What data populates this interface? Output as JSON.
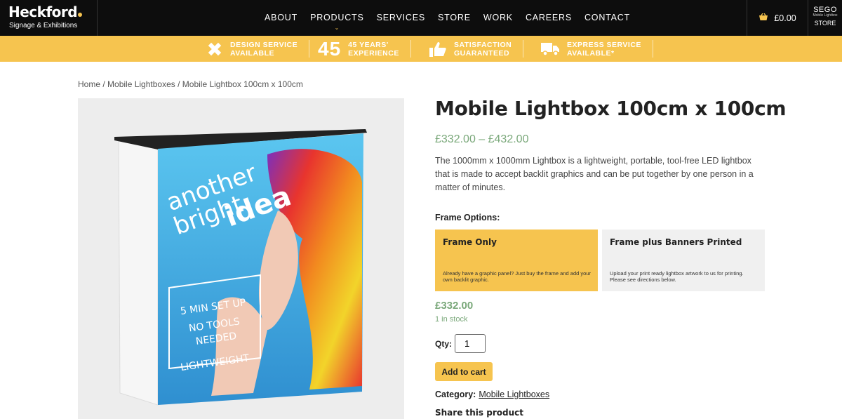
{
  "header": {
    "logo_main": "Heckford",
    "logo_sub": "Signage & Exhibitions",
    "nav": [
      {
        "label": "ABOUT"
      },
      {
        "label": "PRODUCTS"
      },
      {
        "label": "SERVICES"
      },
      {
        "label": "STORE"
      },
      {
        "label": "WORK"
      },
      {
        "label": "CAREERS"
      },
      {
        "label": "CONTACT"
      }
    ],
    "cart_total": "£0.00",
    "store_brand": "SEGO",
    "store_tiny": "Mobile Lightbox",
    "store_label": "STORE"
  },
  "banner": {
    "items": [
      {
        "line1": "DESIGN SERVICE",
        "line2": "AVAILABLE",
        "icon": "pencil-ruler-icon"
      },
      {
        "big": "45",
        "line1": "45 YEARS'",
        "line2": "EXPERIENCE"
      },
      {
        "line1": "SATISFACTION",
        "line2": "GUARANTEED",
        "icon": "thumbs-up-icon"
      },
      {
        "line1": "EXPRESS SERVICE",
        "line2": "AVAILABLE*",
        "icon": "truck-icon"
      }
    ]
  },
  "breadcrumb": {
    "home": "Home",
    "category": "Mobile Lightboxes",
    "current": "Mobile Lightbox 100cm x 100cm",
    "separator": " / "
  },
  "product_image": {
    "text_line1": "another",
    "text_line2": "bright",
    "text_line3": "idea",
    "box_line1": "5 MIN SET UP",
    "box_line2": "NO TOOLS",
    "box_line3": "NEEDED",
    "box_line4": "LIGHTWEIGHT"
  },
  "product": {
    "title": "Mobile Lightbox 100cm x 100cm",
    "price_range": "£332.00 – £432.00",
    "description": "The 1000mm x 1000mm Lightbox is a lightweight, portable, tool-free LED lightbox that is made to accept backlit graphics and can be put together by one person in a matter of minutes.",
    "frame_options_label": "Frame Options:",
    "options": [
      {
        "title": "Frame Only",
        "text": "Already have a graphic panel? Just buy the frame and add your own backlit graphic.",
        "selected": true
      },
      {
        "title": "Frame plus Banners Printed",
        "text": "Upload your print ready lightbox artwork to us for printing. Please see directions below.",
        "selected": false
      }
    ],
    "price": "£332.00",
    "stock": "1 in stock",
    "qty_label": "Qty:",
    "qty_value": "1",
    "add_to_cart": "Add to cart",
    "category_label": "Category:",
    "category_link": "Mobile Lightboxes",
    "share_label": "Share this product"
  },
  "colors": {
    "accent": "#f6c44f",
    "header_bg": "#0d0d0d",
    "price_green": "#7aa87a"
  }
}
